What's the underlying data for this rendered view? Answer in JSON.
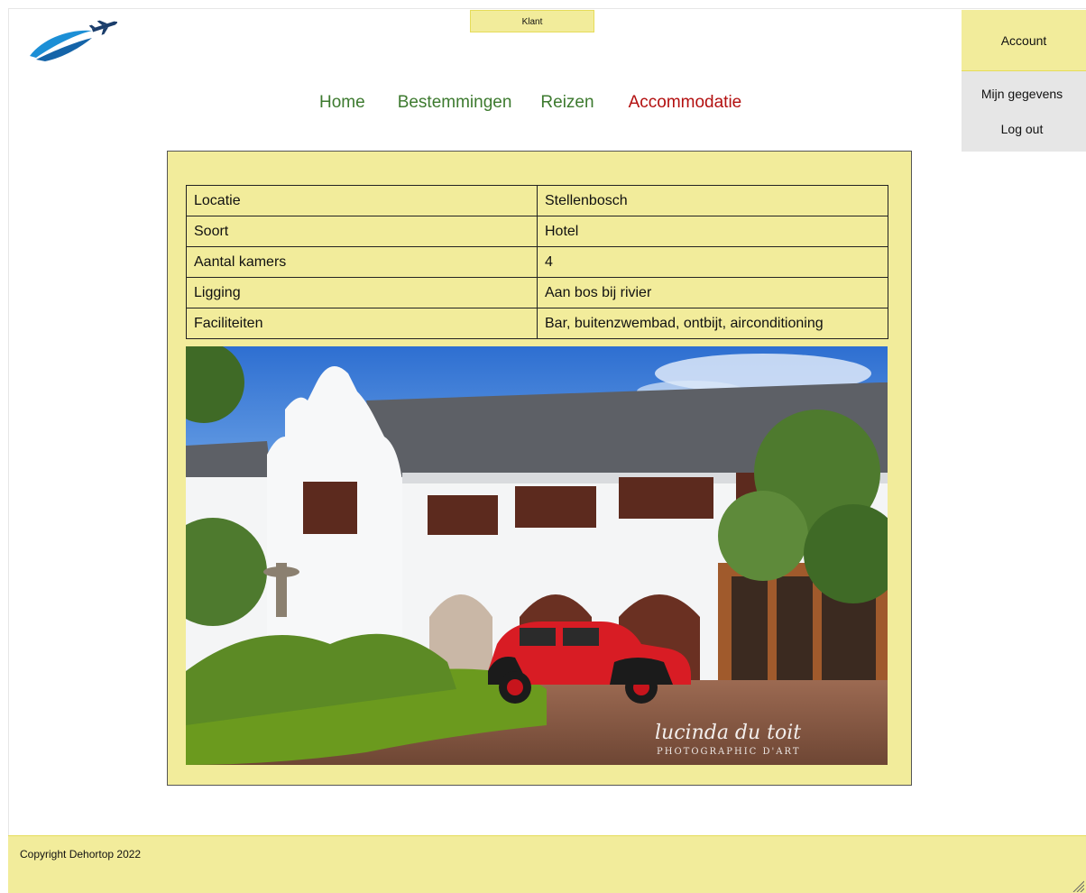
{
  "header": {
    "role_badge": "Klant"
  },
  "nav": {
    "items": [
      {
        "label": "Home",
        "active": false
      },
      {
        "label": "Bestemmingen",
        "active": false
      },
      {
        "label": "Reizen",
        "active": false
      },
      {
        "label": "Accommodatie",
        "active": true
      }
    ]
  },
  "account": {
    "button_label": "Account",
    "menu": [
      "Mijn gegevens",
      "Log out"
    ]
  },
  "accommodation": {
    "rows": [
      {
        "key": "Locatie",
        "value": "Stellenbosch"
      },
      {
        "key": "Soort",
        "value": "Hotel"
      },
      {
        "key": "Aantal kamers",
        "value": "4"
      },
      {
        "key": "Ligging",
        "value": "Aan bos bij rivier"
      },
      {
        "key": "Faciliteiten",
        "value": "Bar, buitenzwembad, ontbijt, airconditioning"
      }
    ],
    "photo_watermark": "lucinda du toit",
    "photo_watermark_sub": "PHOTOGRAPHIC D'ART"
  },
  "footer": {
    "copyright": "Copyright Dehortop 2022"
  },
  "icons": {
    "logo": "airplane-logo-icon",
    "resize": "resize-handle-icon"
  },
  "colors": {
    "accent_yellow": "#f2ec9b",
    "nav_green": "#3d7a2f",
    "nav_active_red": "#b31010"
  }
}
